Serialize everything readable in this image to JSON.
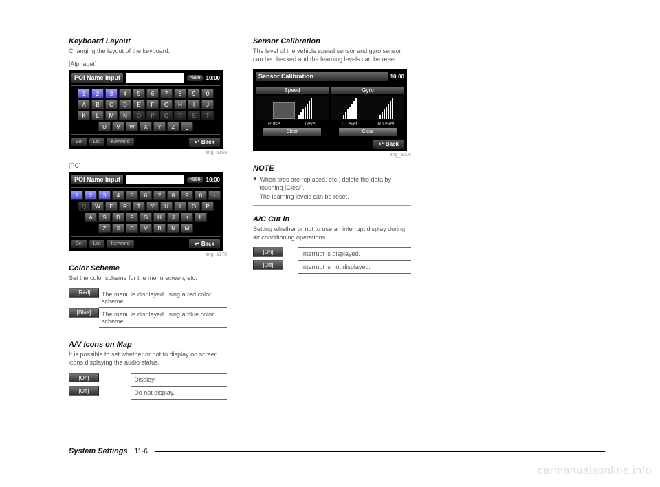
{
  "left": {
    "keyboard": {
      "title": "Keyboard Layout",
      "desc": "Changing the layout of the keyboard.",
      "alpha_label": "[Alphabet]",
      "pc_label": "[PC]",
      "figref1": "eng_a169",
      "figref2": "eng_a170"
    },
    "screen_common": {
      "title": "POI Name Input",
      "count": ">999",
      "time": "10:00",
      "btn_set": "Set",
      "btn_list": "List",
      "btn_keyword": "Keyword",
      "btn_back": "Back"
    },
    "kb_alpha": {
      "row1": [
        "1",
        "2",
        "3",
        "4",
        "5",
        "6",
        "7",
        "8",
        "9",
        "0"
      ],
      "row2": [
        "A",
        "B",
        "C",
        "D",
        "E",
        "F",
        "G",
        "H",
        "I",
        "J"
      ],
      "row3": [
        "K",
        "L",
        "M",
        "N",
        "O",
        "P",
        "Q",
        "R",
        "S",
        "T"
      ],
      "row4": [
        "U",
        "V",
        "W",
        "X",
        "Y",
        "Z",
        "␣"
      ]
    },
    "kb_pc": {
      "row1": [
        "1",
        "2",
        "3",
        "4",
        "5",
        "6",
        "7",
        "8",
        "9",
        "0",
        "-"
      ],
      "row2": [
        "Q",
        "W",
        "E",
        "R",
        "T",
        "Y",
        "U",
        "I",
        "O",
        "P"
      ],
      "row3": [
        "A",
        "S",
        "D",
        "F",
        "G",
        "H",
        "J",
        "K",
        "L"
      ],
      "row4": [
        "Z",
        "X",
        "C",
        "V",
        "B",
        "N",
        "M"
      ]
    },
    "color": {
      "title": "Color Scheme",
      "desc": "Set the color scheme for the menu screen, etc.",
      "rows": [
        {
          "k": "[Red]",
          "v": "The menu is displayed using a red color scheme."
        },
        {
          "k": "[Blue]",
          "v": "The menu is displayed using a blue color scheme."
        }
      ]
    },
    "avicons": {
      "title": "A/V Icons on Map",
      "desc": "It is possible to set whether or not to display on screen icons displaying the audio status.",
      "rows": [
        {
          "k": "[On]",
          "v": "Display."
        },
        {
          "k": "[Off]",
          "v": "Do not display."
        }
      ]
    }
  },
  "right": {
    "sensor": {
      "title": "Sensor Calibration",
      "desc": "The level of the vehicle speed sensor and gyro sensor can be checked and the learning levels can be reset.",
      "figref": "eng_a206",
      "screen_title": "Sensor Calibration",
      "time": "10:00",
      "col1_head": "Speed",
      "col2_head": "Gyro",
      "pulse": "Pulse",
      "level": "Level",
      "llevel": "L Level",
      "rlevel": "R Level",
      "clear": "Clear",
      "back": "Back"
    },
    "note": {
      "title": "NOTE",
      "b1": "When tires are replaced, etc., delete the data by touching [Clear].",
      "b2": "The learning levels can be reset."
    },
    "ac": {
      "title": "A/C Cut in",
      "desc": "Setting whether or not to use an interrupt display during air conditioning operations.",
      "rows": [
        {
          "k": "[On]",
          "v": "Interrupt is displayed."
        },
        {
          "k": "[Off]",
          "v": "Interrupt is not displayed."
        }
      ]
    }
  },
  "footer": {
    "section": "System Settings",
    "page": "11-6"
  },
  "watermark": "carmanualsonline.info"
}
